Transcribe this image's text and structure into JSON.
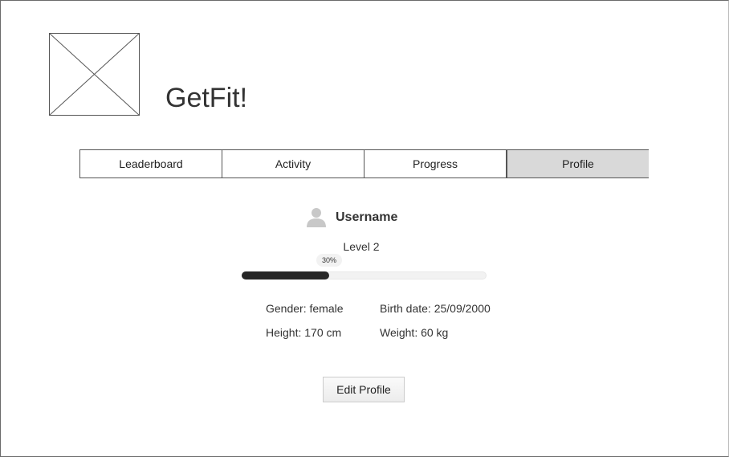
{
  "app": {
    "title": "GetFit!",
    "logo": "image-placeholder"
  },
  "tabs": [
    {
      "label": "Leaderboard"
    },
    {
      "label": "Activity"
    },
    {
      "label": "Progress"
    },
    {
      "label": "Profile",
      "selected": true
    }
  ],
  "profile": {
    "avatar_icon": "user-icon",
    "username": "Username",
    "level": "Level 2",
    "progress_label": "30%",
    "progress_percent": 36,
    "gender": "Gender: female",
    "birth_date": "Birth date: 25/09/2000",
    "height": "Height: 170 cm",
    "weight": "Weight: 60 kg",
    "edit_button": "Edit Profile"
  },
  "colors": {
    "selected_tab": "#d9d9d9",
    "progress_fill": "#262626",
    "progress_track": "#f2f2f2"
  }
}
